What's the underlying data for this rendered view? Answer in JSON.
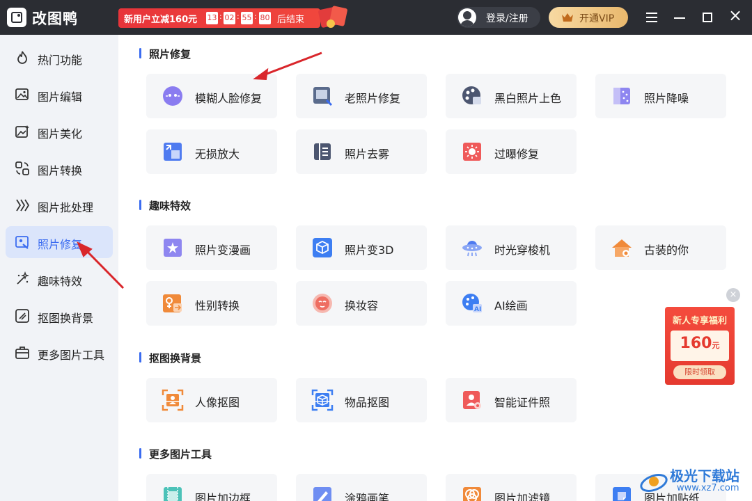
{
  "app": {
    "title": "改图鸭"
  },
  "promo": {
    "text": "新用户立减160元",
    "timer": [
      "13",
      "02",
      "55",
      "80"
    ],
    "end": "后结束"
  },
  "account": {
    "login_label": "登录/注册",
    "vip_label": "开通VIP"
  },
  "sidebar": {
    "items": [
      {
        "label": "热门功能",
        "icon": "flame-icon"
      },
      {
        "label": "图片编辑",
        "icon": "image-edit-icon"
      },
      {
        "label": "图片美化",
        "icon": "image-beautify-icon"
      },
      {
        "label": "图片转换",
        "icon": "convert-icon"
      },
      {
        "label": "图片批处理",
        "icon": "batch-icon"
      },
      {
        "label": "照片修复",
        "icon": "photo-repair-icon",
        "active": true
      },
      {
        "label": "趣味特效",
        "icon": "sparkle-icon"
      },
      {
        "label": "抠图换背景",
        "icon": "cutout-icon"
      },
      {
        "label": "更多图片工具",
        "icon": "toolbox-icon"
      }
    ]
  },
  "sections": [
    {
      "title": "照片修复",
      "cards": [
        "模糊人脸修复",
        "老照片修复",
        "黑白照片上色",
        "照片降噪",
        "无损放大",
        "照片去雾",
        "过曝修复"
      ]
    },
    {
      "title": "趣味特效",
      "cards": [
        "照片变漫画",
        "照片变3D",
        "时光穿梭机",
        "古装的你",
        "性别转换",
        "换妆容",
        "AI绘画"
      ]
    },
    {
      "title": "抠图换背景",
      "cards": [
        "人像抠图",
        "物品抠图",
        "智能证件照"
      ]
    },
    {
      "title": "更多图片工具",
      "cards": [
        "图片加边框",
        "涂鸦画笔",
        "图片加滤镜",
        "图片加贴纸"
      ]
    }
  ],
  "popup": {
    "title": "新人专享福利",
    "amount": "160",
    "unit": "元",
    "button": "限时领取"
  },
  "watermark": {
    "text": "极光下载站",
    "url": "www.xz7.com"
  },
  "colors": {
    "accent": "#3b6cf0",
    "titlebar": "#2b2d33",
    "promo_red": "#e8343a",
    "arrow": "#d9262b"
  }
}
